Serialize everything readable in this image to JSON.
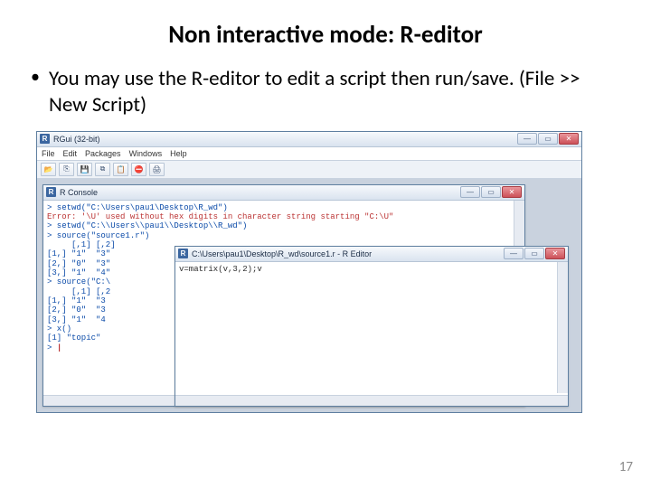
{
  "slide": {
    "title": "Non interactive mode: R-editor",
    "bullet": "You may use the R-editor to edit a script then run/save.  (File >> New Script)",
    "page_number": "17"
  },
  "rgui": {
    "title": "RGui (32-bit)",
    "menu": [
      "File",
      "Edit",
      "Packages",
      "Windows",
      "Help"
    ],
    "toolbar_icons": [
      "open-icon",
      "load-icon",
      "save-icon",
      "copy-icon",
      "paste-icon",
      "stop-icon",
      "print-icon"
    ],
    "toolbar_glyphs": [
      "📂",
      "⎘",
      "💾",
      "⧉",
      "📋",
      "⛔",
      "🖨"
    ],
    "win_buttons": {
      "min": "—",
      "max": "▭",
      "close": "✕"
    }
  },
  "console": {
    "title": "R Console",
    "lines": [
      "> setwd(\"C:\\Users\\pau1\\Desktop\\R_wd\")",
      "Error: '\\U' used without hex digits in character string starting \"C:\\U\"",
      "> setwd(\"C:\\\\Users\\\\pau1\\\\Desktop\\\\R_wd\")",
      "> source(\"source1.r\")",
      "     [,1] [,2]",
      "[1,] \"1\"  \"3\"",
      "[2,] \"0\"  \"3\"",
      "[3,] \"1\"  \"4\"",
      "> source(\"C:\\",
      "     [,1] [,2",
      "[1,] \"1\"  \"3",
      "[2,] \"0\"  \"3",
      "[3,] \"1\"  \"4",
      "> x()",
      "[1] \"topic\"",
      "> "
    ],
    "error_line_index": 1
  },
  "reditor": {
    "title": "C:\\Users\\pau1\\Desktop\\R_wd\\source1.r - R Editor",
    "code": "v=matrix(v,3,2);v"
  }
}
